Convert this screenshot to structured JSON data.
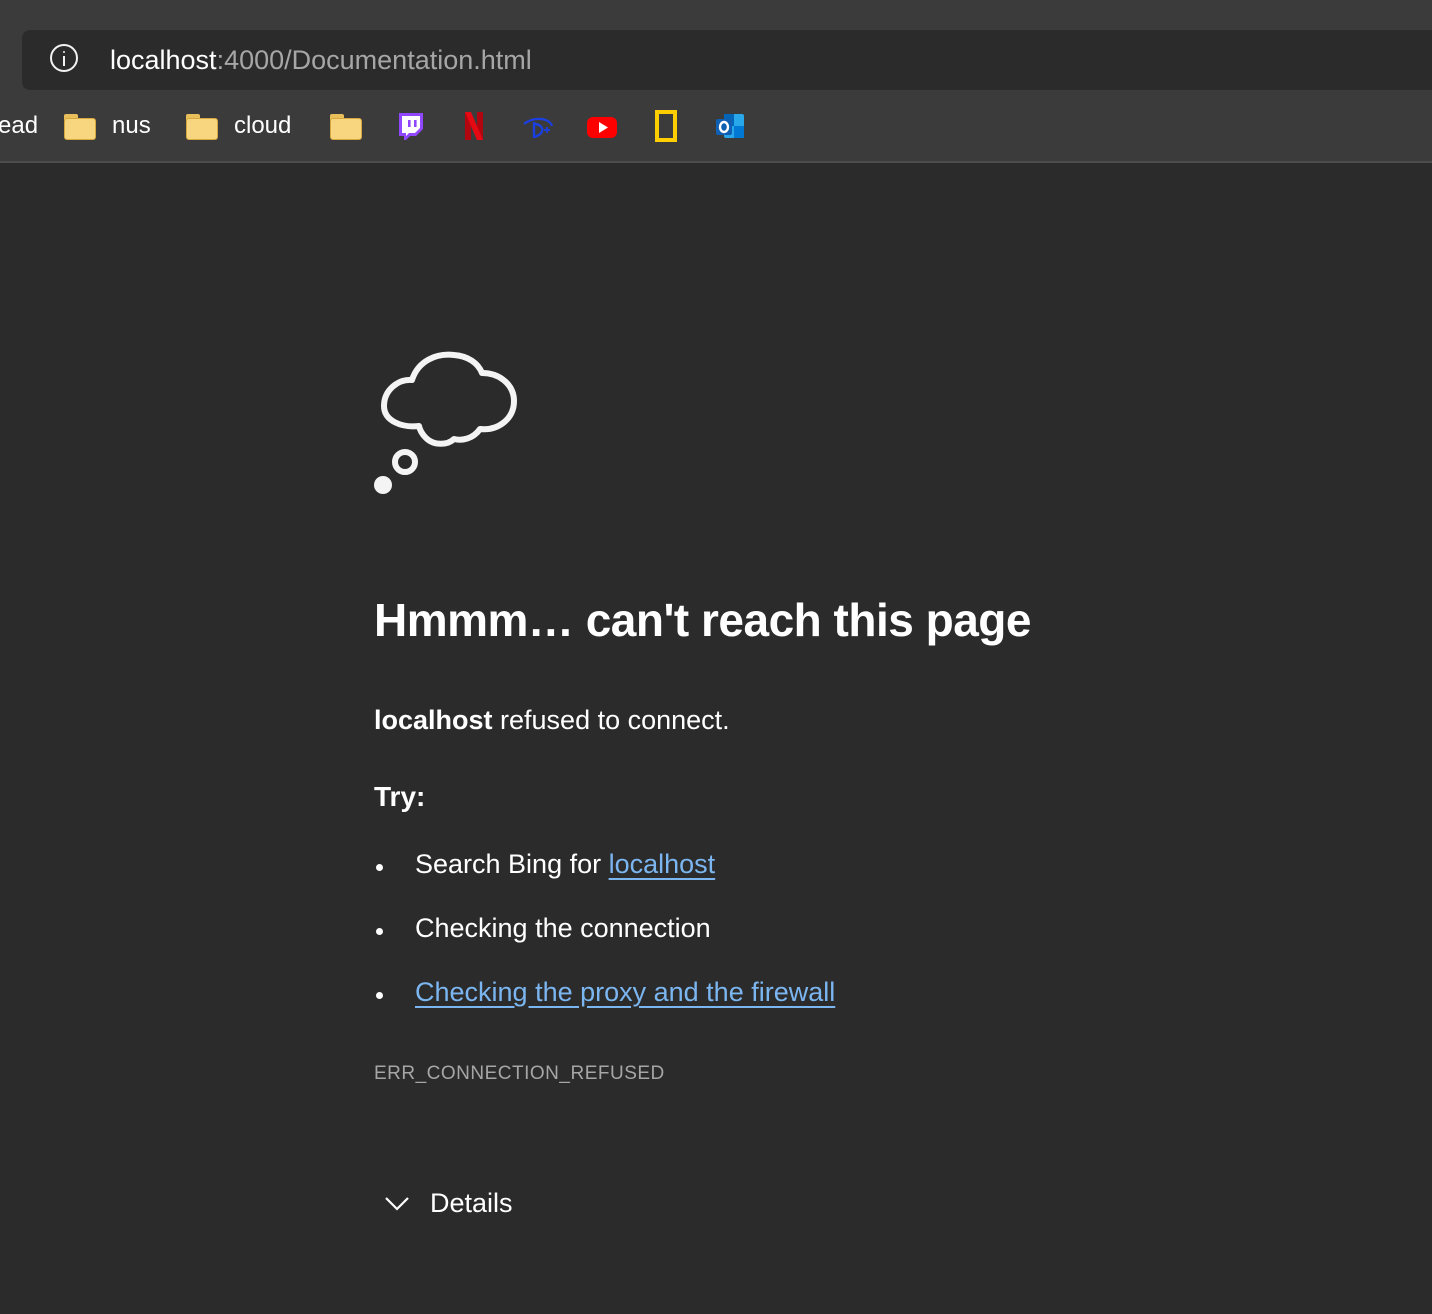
{
  "address_bar": {
    "host": "localhost",
    "path": ":4000/Documentation.html"
  },
  "bookmarks": {
    "truncated_label": "ead",
    "folders": [
      {
        "label": "nus",
        "icon": "folder-icon"
      },
      {
        "label": "cloud",
        "icon": "folder-icon"
      },
      {
        "label": "",
        "icon": "folder-icon"
      }
    ],
    "sites": [
      {
        "icon": "twitch-icon",
        "color": "#9146ff"
      },
      {
        "icon": "netflix-icon",
        "color": "#e50914"
      },
      {
        "icon": "disney-plus-icon",
        "color": "#1b3fe0"
      },
      {
        "icon": "youtube-icon",
        "color": "#ff0000"
      },
      {
        "icon": "national-geographic-icon",
        "color": "#ffce00"
      },
      {
        "icon": "outlook-icon",
        "color": "#0078d4"
      }
    ]
  },
  "error_page": {
    "icon": "thought-cloud-icon",
    "headline": "Hmmm… can't reach this page",
    "message_bold": "localhost",
    "message_rest": " refused to connect.",
    "try_label": "Try:",
    "suggestions": {
      "search_prefix": "Search Bing for ",
      "search_link": "localhost",
      "connection": "Checking the connection",
      "proxy_link": "Checking the proxy and the firewall"
    },
    "error_code": "ERR_CONNECTION_REFUSED",
    "details_label": "Details"
  },
  "colors": {
    "page_bg": "#2b2b2b",
    "chrome_bg": "#3b3b3b",
    "link": "#7bb6f0",
    "muted_text": "#a6a6a6"
  }
}
